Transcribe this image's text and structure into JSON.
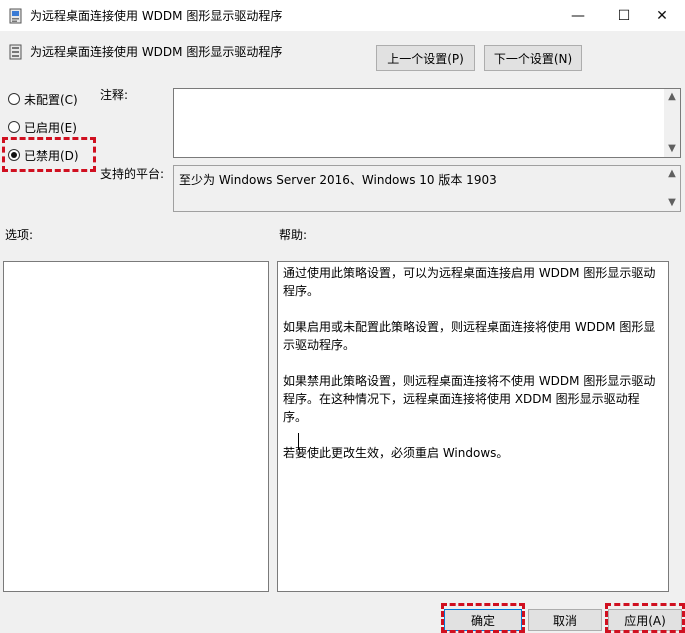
{
  "window": {
    "title": "为远程桌面连接使用 WDDM 图形显示驱动程序",
    "controls": {
      "minimize": "—",
      "maximize": "☐",
      "close": "✕"
    }
  },
  "header": {
    "title": "为远程桌面连接使用 WDDM 图形显示驱动程序",
    "prev_label": "上一个设置(P)",
    "next_label": "下一个设置(N)"
  },
  "state": {
    "options": [
      {
        "label": "未配置(C)",
        "checked": false
      },
      {
        "label": "已启用(E)",
        "checked": false
      },
      {
        "label": "已禁用(D)",
        "checked": true
      }
    ]
  },
  "comment": {
    "label": "注释:",
    "value": ""
  },
  "platform": {
    "label": "支持的平台:",
    "value": "至少为 Windows Server 2016、Windows 10 版本 1903"
  },
  "options_section": {
    "label": "选项:"
  },
  "help_section": {
    "label": "帮助:",
    "paragraphs": [
      "通过使用此策略设置，可以为远程桌面连接启用 WDDM 图形显示驱动程序。",
      "如果启用或未配置此策略设置，则远程桌面连接将使用 WDDM 图形显示驱动程序。",
      "如果禁用此策略设置，则远程桌面连接将不使用 WDDM 图形显示驱动程序。在这种情况下，远程桌面连接将使用 XDDM 图形显示驱动程序。",
      "若要使此更改生效，必须重启 Windows。"
    ]
  },
  "footer": {
    "ok_label": "确定",
    "cancel_label": "取消",
    "apply_label": "应用(A)"
  },
  "colors": {
    "highlight": "#d01020",
    "window_bg": "#f0f0f0"
  },
  "icons": [
    "policy-icon",
    "minimize-icon",
    "maximize-icon",
    "close-icon",
    "scroll-up-icon",
    "scroll-down-icon"
  ]
}
